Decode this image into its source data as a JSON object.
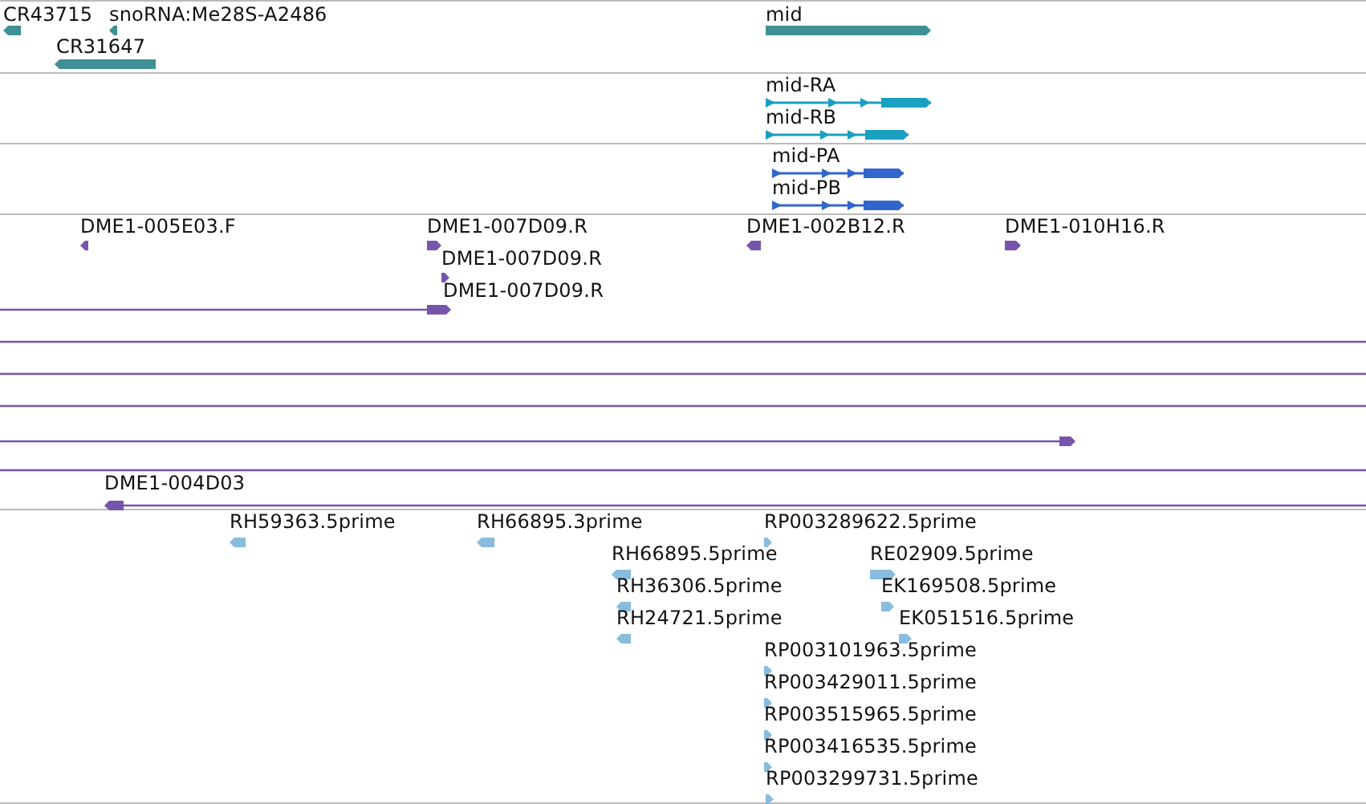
{
  "tracks": [
    {
      "kind": "genes",
      "color": "#3f9094",
      "features": [
        {
          "label": "CR43715",
          "forward": false
        },
        {
          "label": "snoRNA:Me28S-A2486",
          "forward": false
        },
        {
          "label": "CR31647",
          "forward": false
        },
        {
          "label": "mid",
          "forward": true
        }
      ]
    },
    {
      "kind": "transcripts",
      "color": "#1a9fc0",
      "features": [
        {
          "label": "mid-RA",
          "forward": true
        },
        {
          "label": "mid-RB",
          "forward": true
        }
      ]
    },
    {
      "kind": "proteins",
      "color": "#3366cc",
      "features": [
        {
          "label": "mid-PA",
          "forward": true
        },
        {
          "label": "mid-PB",
          "forward": true
        }
      ]
    },
    {
      "kind": "clones",
      "color": "#7755aa",
      "features": [
        {
          "kind": "read",
          "label": "DME1-005E03.F",
          "forward": false
        },
        {
          "kind": "read",
          "label": "DME1-007D09.R",
          "forward": true
        },
        {
          "kind": "read",
          "label": "DME1-007D09.R",
          "forward": true
        },
        {
          "kind": "read-span",
          "label": "DME1-007D09.R",
          "forward": true
        },
        {
          "kind": "read",
          "label": "DME1-002B12.R",
          "forward": false
        },
        {
          "kind": "read",
          "label": "DME1-010H16.R",
          "forward": true
        },
        {
          "kind": "span"
        },
        {
          "kind": "span"
        },
        {
          "kind": "span"
        },
        {
          "kind": "read-span",
          "forward": true
        },
        {
          "kind": "span"
        },
        {
          "kind": "read-span",
          "label": "DME1-004D03",
          "forward": false
        }
      ]
    },
    {
      "kind": "ests",
      "color": "#88bbdd",
      "features": [
        {
          "label": "RH59363.5prime",
          "forward": false
        },
        {
          "label": "RH66895.3prime",
          "forward": false
        },
        {
          "label": "RP003289622.5prime",
          "forward": true
        },
        {
          "label": "RH66895.5prime",
          "forward": false
        },
        {
          "label": "RE02909.5prime",
          "forward": true
        },
        {
          "label": "RH36306.5prime",
          "forward": false
        },
        {
          "label": "EK169508.5prime",
          "forward": true
        },
        {
          "label": "RH24721.5prime",
          "forward": false
        },
        {
          "label": "EK051516.5prime",
          "forward": true
        },
        {
          "label": "RP003101963.5prime",
          "forward": true
        },
        {
          "label": "RP003429011.5prime",
          "forward": true
        },
        {
          "label": "RP003515965.5prime",
          "forward": true
        },
        {
          "label": "RP003416535.5prime",
          "forward": true
        },
        {
          "label": "RP003299731.5prime",
          "forward": true
        }
      ]
    }
  ]
}
